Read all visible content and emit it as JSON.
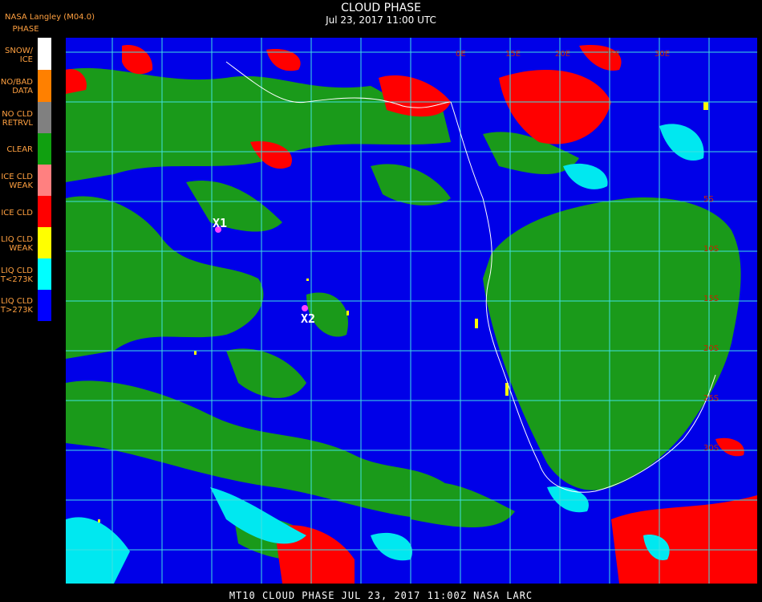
{
  "header": {
    "title": "CLOUD PHASE",
    "subtitle": "Jul 23, 2017 11:00 UTC",
    "org": "NASA Langley (M04.0)"
  },
  "legend": {
    "heading": "PHASE",
    "items": [
      {
        "label": "SNOW/\nICE",
        "color": "#ffffff"
      },
      {
        "label": "NO/BAD\nDATA",
        "color": "#ff8000"
      },
      {
        "label": "NO CLD\nRETRVL",
        "color": "#808080"
      },
      {
        "label": "CLEAR",
        "color": "#10a010"
      },
      {
        "label": "ICE CLD\nWEAK",
        "color": "#ff8080"
      },
      {
        "label": "ICE CLD",
        "color": "#ff0000"
      },
      {
        "label": "LIQ CLD\nWEAK",
        "color": "#ffff00"
      },
      {
        "label": "LIQ CLD\nT<273K",
        "color": "#00ffff"
      },
      {
        "label": "LIQ CLD\nT>273K",
        "color": "#0000ff"
      }
    ]
  },
  "map": {
    "markers": [
      {
        "label": "X1",
        "color": "#ff40ff"
      },
      {
        "label": "X2",
        "color": "#ff40ff"
      }
    ],
    "grid_labels": [
      "0E",
      "15E",
      "20E",
      "25E",
      "30E",
      "5S",
      "10S",
      "15S",
      "20S",
      "25S",
      "30S"
    ]
  },
  "footer": {
    "text": "MT10  CLOUD PHASE   JUL 23, 2017 11:00Z   NASA LARC"
  }
}
